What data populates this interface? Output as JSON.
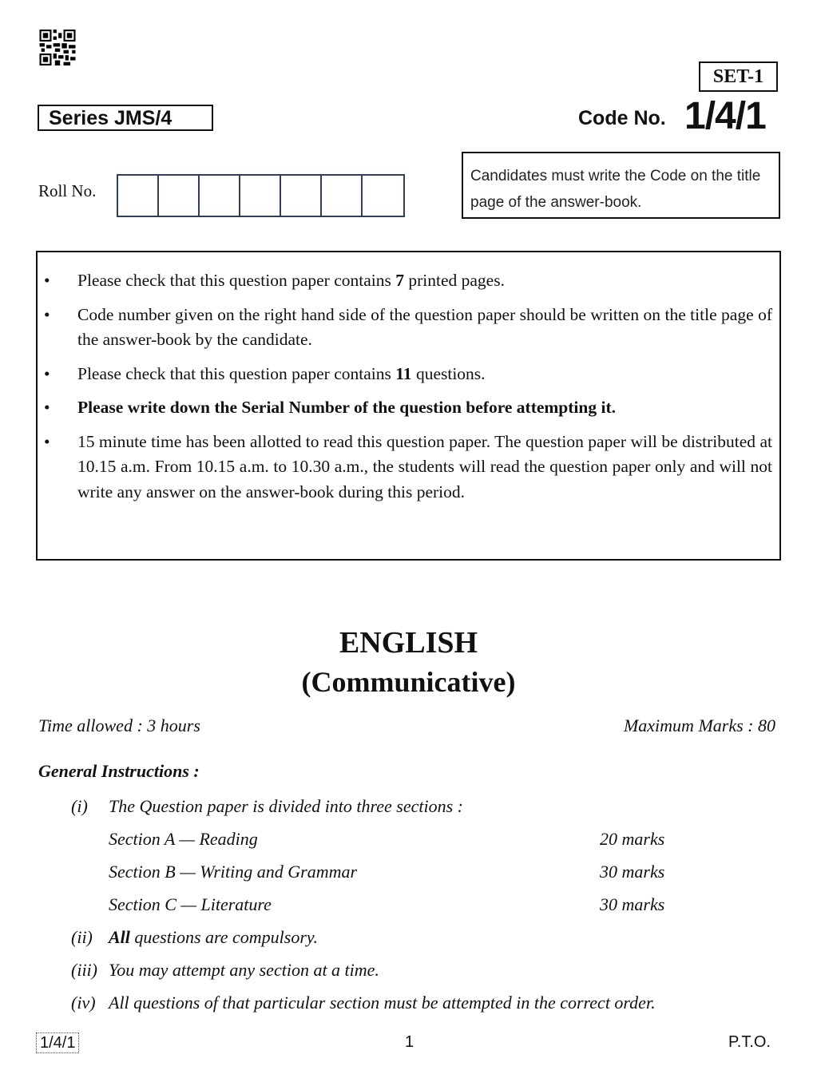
{
  "header": {
    "qr_icon": "qr-code-icon",
    "series": "Series JMS/4",
    "set": "SET-1",
    "code_label": "Code No.",
    "code_number": "1/4/1",
    "roll_label": "Roll No.",
    "roll_boxes": 7,
    "notice": "Candidates must write the Code on the title page of the answer-book."
  },
  "instructions": [
    {
      "pre": "Please check that this question paper contains ",
      "bold": "7",
      "post": " printed pages."
    },
    {
      "pre": "Code number given on the right hand side of the question paper should be written on the title page of the answer-book by the candidate.",
      "bold": "",
      "post": ""
    },
    {
      "pre": "Please check that this question paper contains ",
      "bold": "11",
      "post": " questions."
    },
    {
      "pre": "",
      "bold": "Please write down the Serial Number of the question before attempting it.",
      "post": ""
    },
    {
      "pre": "15 minute time has been allotted to read this question paper. The question paper will be distributed at 10.15 a.m. From 10.15 a.m. to 10.30 a.m., the students will read the question paper only and will not write any answer on the answer-book during this period.",
      "bold": "",
      "post": ""
    }
  ],
  "title": {
    "subject": "ENGLISH",
    "subtitle": "(Communicative)"
  },
  "meta": {
    "time_allowed": "Time allowed : 3 hours",
    "max_marks": "Maximum Marks : 80"
  },
  "general": {
    "heading": "General Instructions :",
    "i_num": "(i)",
    "i_text": "The Question paper is divided into three sections :",
    "sections": [
      {
        "name": "Section A — Reading",
        "marks": "20 marks"
      },
      {
        "name": "Section B — Writing and Grammar",
        "marks": "30 marks"
      },
      {
        "name": "Section C — Literature",
        "marks": "30 marks"
      }
    ],
    "ii_num": "(ii)",
    "ii_bold": "All",
    "ii_text": " questions are compulsory.",
    "iii_num": "(iii)",
    "iii_text": "You may attempt any section at a time.",
    "iv_num": "(iv)",
    "iv_text": "All questions of that particular section must be attempted in the correct order."
  },
  "footer": {
    "code": "1/4/1",
    "page": "1",
    "pto": "P.T.O."
  }
}
